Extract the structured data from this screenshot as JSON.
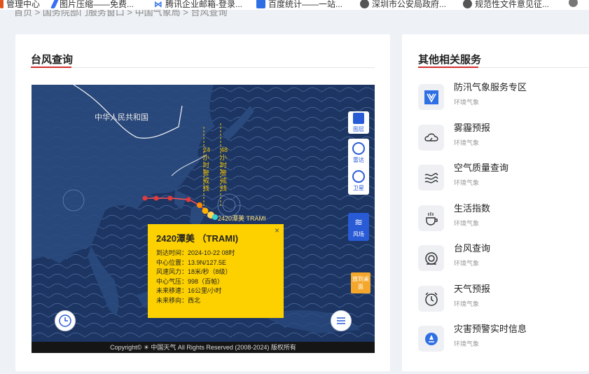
{
  "bookmarks": [
    {
      "label": "管理中心",
      "icon": "bookmark-icon",
      "color": "#e0531b"
    },
    {
      "label": "图片压缩——免费...",
      "icon": "compress-icon",
      "color": "#3b6ef5"
    },
    {
      "label": "腾讯企业邮箱-登录...",
      "icon": "mail-icon",
      "color": "#2f6fe4"
    },
    {
      "label": "百度统计——一站...",
      "icon": "baidu-stats-icon",
      "color": "#2f6fe4"
    },
    {
      "label": "深圳市公安局政府...",
      "icon": "globe-icon",
      "color": "#555555"
    },
    {
      "label": "规范性文件意见征...",
      "icon": "globe-icon",
      "color": "#555555"
    }
  ],
  "breadcrumb": "首页 > 国务院部门服务窗口 > 中国气象局 > 台风查询",
  "left_panel": {
    "title": "台风查询"
  },
  "map": {
    "labels": {
      "china": "中华人民共和国",
      "forecast_24": "24小时警戒线",
      "forecast_48": "48小时警戒线",
      "storm_label": "2420潭美 TRAMI"
    },
    "tools": [
      {
        "label": "图层",
        "icon": "layers-icon"
      },
      {
        "label": "雷达",
        "icon": "radar-icon"
      },
      {
        "label": "卫星",
        "icon": "satellite-icon"
      },
      {
        "label": "风场",
        "icon": "wind-field-icon",
        "active": true
      }
    ],
    "desk_button": "放到桌面",
    "footer": "Copyright© ☀ 中国天气 All Rights Reserved (2008-2024) 版权所有"
  },
  "popup": {
    "title": "2420潭美 （TRAMI)",
    "close": "×",
    "rows": [
      "到达时间：2024-10-22 08时",
      "中心位置：13.9N/127.5E",
      "风速风力：18米/秒（8级）",
      "中心气压：998（百帕）",
      "未来移速：16公里/小时",
      "未来移向：西北"
    ]
  },
  "right_panel": {
    "title": "其他相关服务",
    "services": [
      {
        "name": "防汛气象服务专区",
        "sub": "环境气象",
        "icon": "flood-icon"
      },
      {
        "name": "雾霾预报",
        "sub": "环境气象",
        "icon": "haze-icon"
      },
      {
        "name": "空气质量查询",
        "sub": "环境气象",
        "icon": "air-quality-icon"
      },
      {
        "name": "生活指数",
        "sub": "环境气象",
        "icon": "life-index-icon"
      },
      {
        "name": "台风查询",
        "sub": "环境气象",
        "icon": "typhoon-icon"
      },
      {
        "name": "天气预报",
        "sub": "环境气象",
        "icon": "alarm-clock-icon"
      },
      {
        "name": "灾害预警实时信息",
        "sub": "环境气象",
        "icon": "warning-icon"
      }
    ]
  },
  "colors": {
    "accent_red": "#d32f2f",
    "map_sea": "#1c3563",
    "popup_yellow": "#fdd100",
    "tool_blue": "#2a5bd7"
  }
}
